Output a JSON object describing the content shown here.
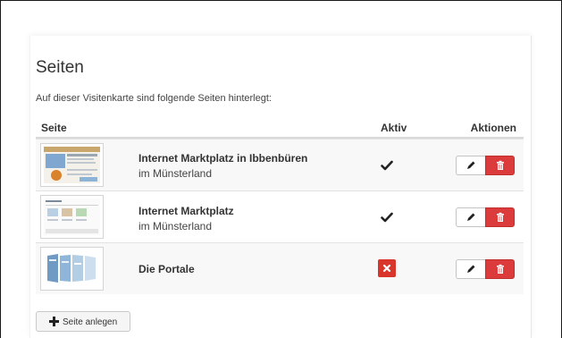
{
  "header": {
    "title": "Seiten",
    "intro": "Auf dieser Visitenkarte sind folgende Seiten hinterlegt:"
  },
  "table": {
    "columns": {
      "seite": "Seite",
      "aktiv": "Aktiv",
      "aktionen": "Aktionen"
    },
    "rows": [
      {
        "name": "Internet Marktplatz in Ibbenbüren",
        "subtitle": "im Münsterland",
        "active": true
      },
      {
        "name": "Internet Marktplatz",
        "subtitle": "im Münsterland",
        "active": true
      },
      {
        "name": "Die Portale",
        "subtitle": "",
        "active": false
      }
    ]
  },
  "add_button": {
    "label": "Seite anlegen"
  },
  "colors": {
    "delete_red": "#dc3b3b",
    "inactive_red": "#d9362b",
    "check": "#222222"
  },
  "icons": {
    "edit": "pencil-icon",
    "delete": "trash-icon",
    "active": "checkmark-icon",
    "inactive": "x-icon",
    "add": "plus-icon"
  }
}
